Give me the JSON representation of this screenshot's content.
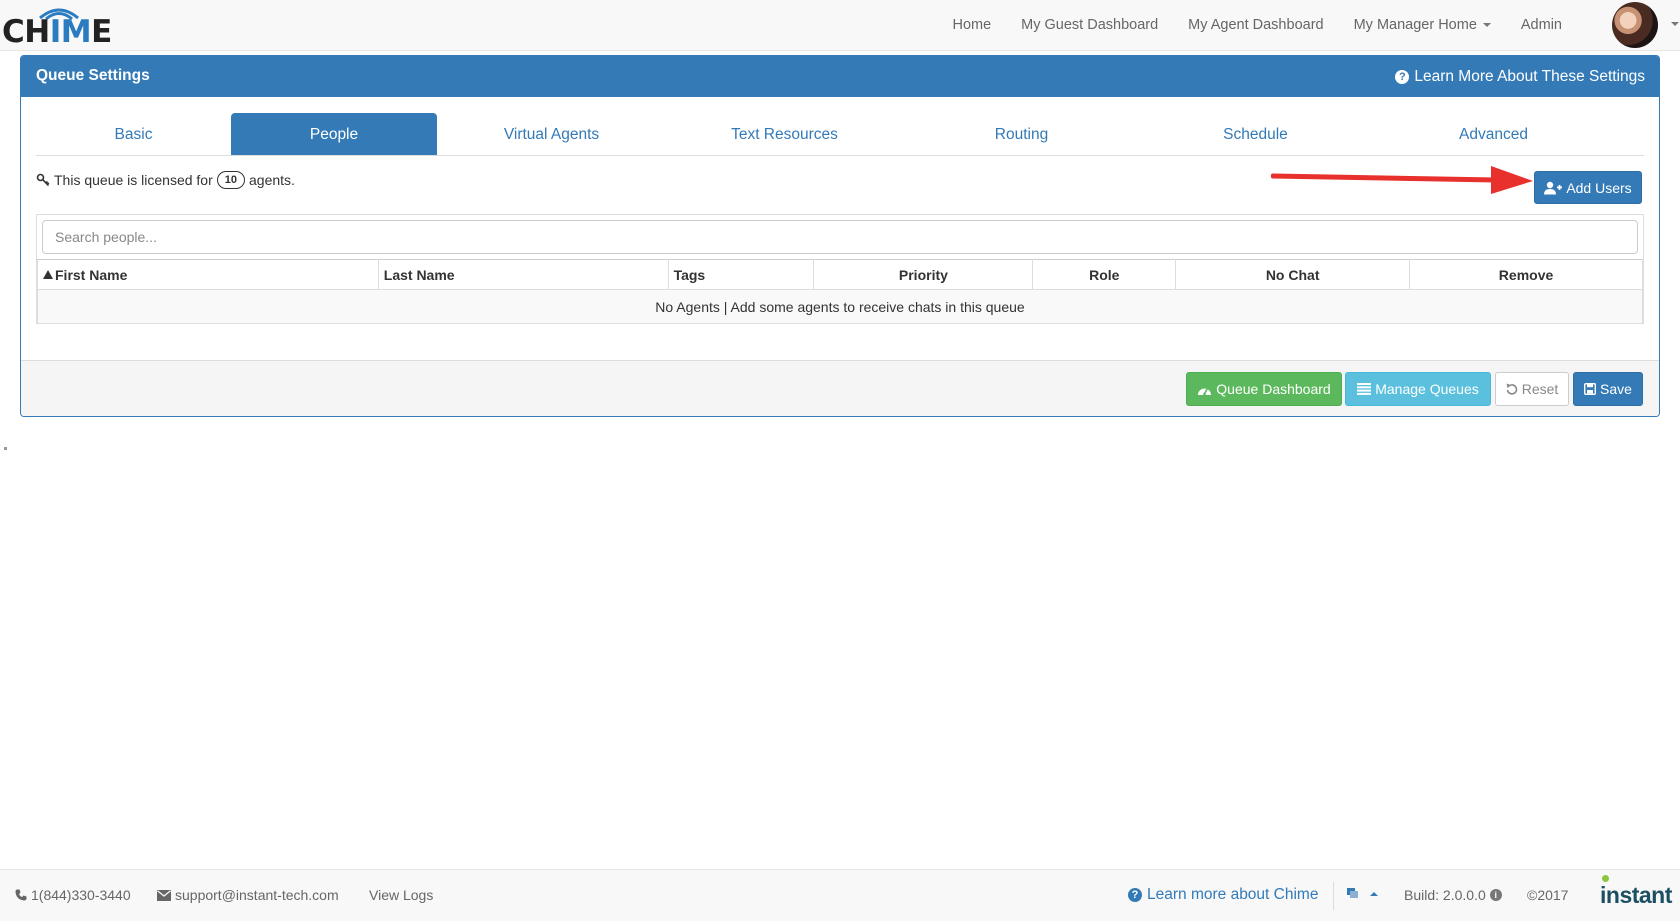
{
  "brand": {
    "logo_text_prefix": "CH",
    "logo_text_accent": "IM",
    "logo_text_suffix": "E",
    "accent_color": "#337ab7"
  },
  "nav": {
    "links": [
      "Home",
      "My Guest Dashboard",
      "My Agent Dashboard",
      "My Manager Home",
      "Admin"
    ]
  },
  "panel": {
    "title": "Queue Settings",
    "learn_more": "Learn More About These Settings",
    "tabs": [
      "Basic",
      "People",
      "Virtual Agents",
      "Text Resources",
      "Routing",
      "Schedule",
      "Advanced"
    ],
    "active_tab": "People",
    "license": {
      "prefix": "This queue is licensed for",
      "count": "10",
      "suffix": "agents."
    },
    "add_users_label": "Add Users",
    "search_placeholder": "Search people...",
    "columns": [
      "First Name",
      "Last Name",
      "Tags",
      "Priority",
      "Role",
      "No Chat",
      "Remove"
    ],
    "empty_message": "No Agents | Add some agents to receive chats in this queue",
    "buttons": {
      "queue_dashboard": "Queue Dashboard",
      "manage_queues": "Manage Queues",
      "reset": "Reset",
      "save": "Save"
    }
  },
  "footer": {
    "phone": "1(844)330-3440",
    "email": "support@instant-tech.com",
    "view_logs": "View Logs",
    "learn_more": "Learn more about Chime",
    "build": "Build: 2.0.0.0",
    "copyright": "©2017",
    "vendor": "instant"
  },
  "colors": {
    "primary": "#337ab7",
    "success": "#5cb85c",
    "info": "#5bc0de",
    "annotation_arrow": "#e8302c"
  }
}
